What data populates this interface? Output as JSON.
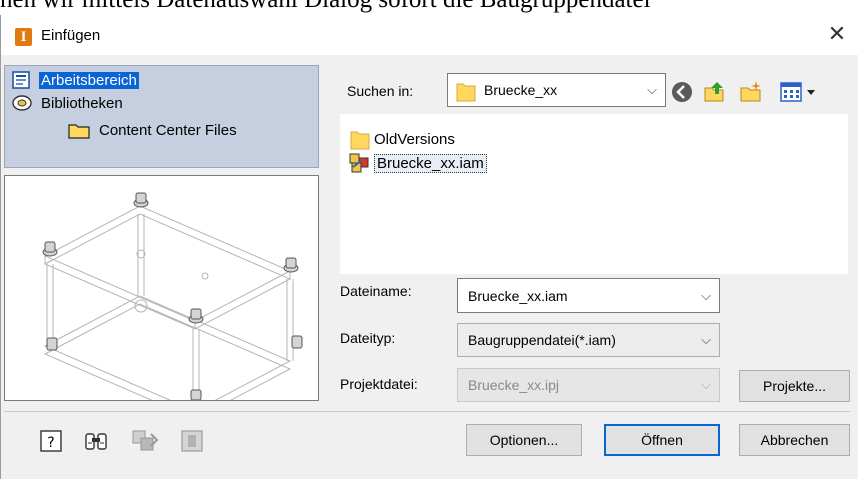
{
  "background_text": "hen wir mittels Datenauswahl Dialog sofort die Baugruppendatei",
  "window": {
    "title": "Einfügen",
    "app_icon_letter": "I",
    "close_glyph": "✕"
  },
  "locations": [
    {
      "label": "Arbeitsbereich",
      "icon": "workspace-icon",
      "selected": true
    },
    {
      "label": "Bibliotheken",
      "icon": "library-icon",
      "selected": false
    },
    {
      "label": "Content Center Files",
      "icon": "folder-icon",
      "selected": false
    }
  ],
  "look_in": {
    "label": "Suchen in:",
    "value": "Bruecke_xx"
  },
  "toolbar_icons": [
    "back-icon",
    "up-folder-icon",
    "new-folder-icon",
    "view-menu-icon"
  ],
  "files": [
    {
      "name": "OldVersions",
      "icon": "folder-icon"
    },
    {
      "name": "Bruecke_xx.iam",
      "icon": "assembly-file-icon",
      "selected": true
    }
  ],
  "filename": {
    "label": "Dateiname:",
    "value": "Bruecke_xx.iam"
  },
  "filetype": {
    "label": "Dateityp:",
    "value": "Baugruppendatei(*.iam)"
  },
  "project": {
    "label": "Projektdatei:",
    "value": "Bruecke_xx.ipj",
    "button": "Projekte..."
  },
  "buttons": {
    "options": "Optionen...",
    "open": "Öffnen",
    "cancel": "Abbrechen"
  },
  "bottom_icons": [
    "help-icon",
    "find-icon",
    "assembly-options-icon",
    "disabled-icon"
  ],
  "colors": {
    "selection": "#0a64d6",
    "location_panel": "#c5cfe0",
    "folder": "#ffd75e",
    "app_icon": "#e07a10"
  }
}
